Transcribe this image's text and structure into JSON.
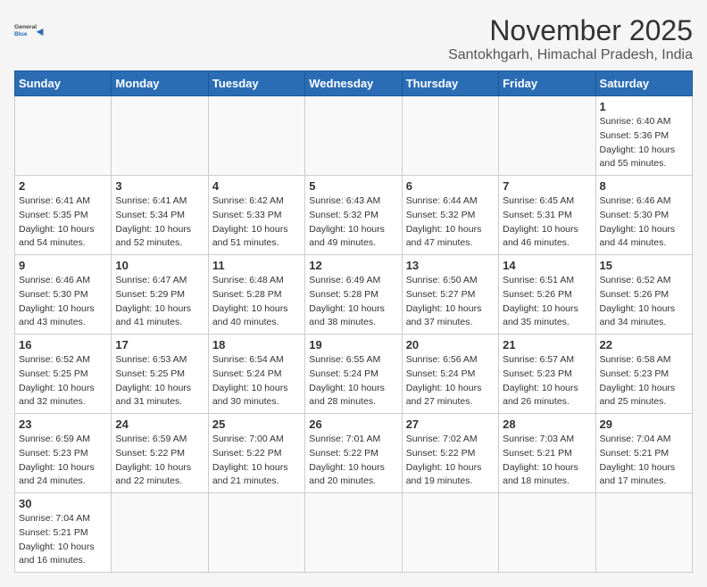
{
  "logo": {
    "text_general": "General",
    "text_blue": "Blue"
  },
  "title": "November 2025",
  "subtitle": "Santokhgarh, Himachal Pradesh, India",
  "weekdays": [
    "Sunday",
    "Monday",
    "Tuesday",
    "Wednesday",
    "Thursday",
    "Friday",
    "Saturday"
  ],
  "days": [
    {
      "num": "",
      "sunrise": "",
      "sunset": "",
      "daylight": ""
    },
    {
      "num": "",
      "sunrise": "",
      "sunset": "",
      "daylight": ""
    },
    {
      "num": "",
      "sunrise": "",
      "sunset": "",
      "daylight": ""
    },
    {
      "num": "",
      "sunrise": "",
      "sunset": "",
      "daylight": ""
    },
    {
      "num": "",
      "sunrise": "",
      "sunset": "",
      "daylight": ""
    },
    {
      "num": "",
      "sunrise": "",
      "sunset": "",
      "daylight": ""
    },
    {
      "num": "1",
      "sunrise": "Sunrise: 6:40 AM",
      "sunset": "Sunset: 5:36 PM",
      "daylight": "Daylight: 10 hours and 55 minutes."
    },
    {
      "num": "2",
      "sunrise": "Sunrise: 6:41 AM",
      "sunset": "Sunset: 5:35 PM",
      "daylight": "Daylight: 10 hours and 54 minutes."
    },
    {
      "num": "3",
      "sunrise": "Sunrise: 6:41 AM",
      "sunset": "Sunset: 5:34 PM",
      "daylight": "Daylight: 10 hours and 52 minutes."
    },
    {
      "num": "4",
      "sunrise": "Sunrise: 6:42 AM",
      "sunset": "Sunset: 5:33 PM",
      "daylight": "Daylight: 10 hours and 51 minutes."
    },
    {
      "num": "5",
      "sunrise": "Sunrise: 6:43 AM",
      "sunset": "Sunset: 5:32 PM",
      "daylight": "Daylight: 10 hours and 49 minutes."
    },
    {
      "num": "6",
      "sunrise": "Sunrise: 6:44 AM",
      "sunset": "Sunset: 5:32 PM",
      "daylight": "Daylight: 10 hours and 47 minutes."
    },
    {
      "num": "7",
      "sunrise": "Sunrise: 6:45 AM",
      "sunset": "Sunset: 5:31 PM",
      "daylight": "Daylight: 10 hours and 46 minutes."
    },
    {
      "num": "8",
      "sunrise": "Sunrise: 6:46 AM",
      "sunset": "Sunset: 5:30 PM",
      "daylight": "Daylight: 10 hours and 44 minutes."
    },
    {
      "num": "9",
      "sunrise": "Sunrise: 6:46 AM",
      "sunset": "Sunset: 5:30 PM",
      "daylight": "Daylight: 10 hours and 43 minutes."
    },
    {
      "num": "10",
      "sunrise": "Sunrise: 6:47 AM",
      "sunset": "Sunset: 5:29 PM",
      "daylight": "Daylight: 10 hours and 41 minutes."
    },
    {
      "num": "11",
      "sunrise": "Sunrise: 6:48 AM",
      "sunset": "Sunset: 5:28 PM",
      "daylight": "Daylight: 10 hours and 40 minutes."
    },
    {
      "num": "12",
      "sunrise": "Sunrise: 6:49 AM",
      "sunset": "Sunset: 5:28 PM",
      "daylight": "Daylight: 10 hours and 38 minutes."
    },
    {
      "num": "13",
      "sunrise": "Sunrise: 6:50 AM",
      "sunset": "Sunset: 5:27 PM",
      "daylight": "Daylight: 10 hours and 37 minutes."
    },
    {
      "num": "14",
      "sunrise": "Sunrise: 6:51 AM",
      "sunset": "Sunset: 5:26 PM",
      "daylight": "Daylight: 10 hours and 35 minutes."
    },
    {
      "num": "15",
      "sunrise": "Sunrise: 6:52 AM",
      "sunset": "Sunset: 5:26 PM",
      "daylight": "Daylight: 10 hours and 34 minutes."
    },
    {
      "num": "16",
      "sunrise": "Sunrise: 6:52 AM",
      "sunset": "Sunset: 5:25 PM",
      "daylight": "Daylight: 10 hours and 32 minutes."
    },
    {
      "num": "17",
      "sunrise": "Sunrise: 6:53 AM",
      "sunset": "Sunset: 5:25 PM",
      "daylight": "Daylight: 10 hours and 31 minutes."
    },
    {
      "num": "18",
      "sunrise": "Sunrise: 6:54 AM",
      "sunset": "Sunset: 5:24 PM",
      "daylight": "Daylight: 10 hours and 30 minutes."
    },
    {
      "num": "19",
      "sunrise": "Sunrise: 6:55 AM",
      "sunset": "Sunset: 5:24 PM",
      "daylight": "Daylight: 10 hours and 28 minutes."
    },
    {
      "num": "20",
      "sunrise": "Sunrise: 6:56 AM",
      "sunset": "Sunset: 5:24 PM",
      "daylight": "Daylight: 10 hours and 27 minutes."
    },
    {
      "num": "21",
      "sunrise": "Sunrise: 6:57 AM",
      "sunset": "Sunset: 5:23 PM",
      "daylight": "Daylight: 10 hours and 26 minutes."
    },
    {
      "num": "22",
      "sunrise": "Sunrise: 6:58 AM",
      "sunset": "Sunset: 5:23 PM",
      "daylight": "Daylight: 10 hours and 25 minutes."
    },
    {
      "num": "23",
      "sunrise": "Sunrise: 6:59 AM",
      "sunset": "Sunset: 5:23 PM",
      "daylight": "Daylight: 10 hours and 24 minutes."
    },
    {
      "num": "24",
      "sunrise": "Sunrise: 6:59 AM",
      "sunset": "Sunset: 5:22 PM",
      "daylight": "Daylight: 10 hours and 22 minutes."
    },
    {
      "num": "25",
      "sunrise": "Sunrise: 7:00 AM",
      "sunset": "Sunset: 5:22 PM",
      "daylight": "Daylight: 10 hours and 21 minutes."
    },
    {
      "num": "26",
      "sunrise": "Sunrise: 7:01 AM",
      "sunset": "Sunset: 5:22 PM",
      "daylight": "Daylight: 10 hours and 20 minutes."
    },
    {
      "num": "27",
      "sunrise": "Sunrise: 7:02 AM",
      "sunset": "Sunset: 5:22 PM",
      "daylight": "Daylight: 10 hours and 19 minutes."
    },
    {
      "num": "28",
      "sunrise": "Sunrise: 7:03 AM",
      "sunset": "Sunset: 5:21 PM",
      "daylight": "Daylight: 10 hours and 18 minutes."
    },
    {
      "num": "29",
      "sunrise": "Sunrise: 7:04 AM",
      "sunset": "Sunset: 5:21 PM",
      "daylight": "Daylight: 10 hours and 17 minutes."
    },
    {
      "num": "30",
      "sunrise": "Sunrise: 7:04 AM",
      "sunset": "Sunset: 5:21 PM",
      "daylight": "Daylight: 10 hours and 16 minutes."
    }
  ]
}
